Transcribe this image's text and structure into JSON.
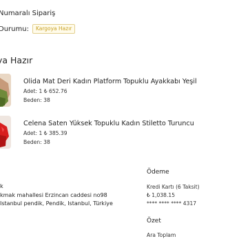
{
  "order": {
    "title": "Numaralı Sipariş",
    "status_label": "Durumu:",
    "status_value": "Kargoya Hazır"
  },
  "section": {
    "heading": "ya Hazır"
  },
  "products": [
    {
      "name": "Olida Mat Deri Kadın Platform Topuklu Ayakkabı Yeşil",
      "qty_price": "Adet: 1 ₺ 652.76",
      "size": "Beden: 38"
    },
    {
      "name": "Celena Saten Yüksek Topuklu Kadın Stiletto Turuncu",
      "qty_price": "Adet: 1 ₺ 385.39",
      "size": "Beden: 38"
    }
  ],
  "address": {
    "line1": "k",
    "line2": "kmak mahallesi Erzincan caddesi no98",
    "line3": "Istanbul pendik, Pendik, Istanbul, Türkiye"
  },
  "payment": {
    "heading": "Ödeme",
    "method": "Kredi Kartı (6 Taksit)",
    "amount": "₺ 1,038.15",
    "card": "**** **** **** 4317"
  },
  "summary": {
    "heading": "Özet",
    "total_label": "Ara Toplam"
  }
}
